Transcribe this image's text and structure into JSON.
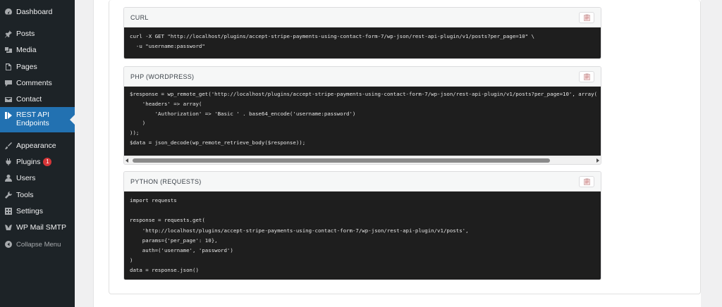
{
  "sidebar": {
    "items": [
      {
        "label": "Dashboard",
        "icon": "dashboard-icon"
      },
      {
        "label": "Posts",
        "icon": "pin-icon"
      },
      {
        "label": "Media",
        "icon": "media-icon"
      },
      {
        "label": "Pages",
        "icon": "page-icon"
      },
      {
        "label": "Comments",
        "icon": "comment-icon"
      },
      {
        "label": "Contact",
        "icon": "envelope-icon"
      },
      {
        "label": "REST API Endpoints",
        "icon": "rest-api-icon",
        "active": true
      },
      {
        "label": "Appearance",
        "icon": "brush-icon"
      },
      {
        "label": "Plugins",
        "icon": "plugin-icon",
        "badge": "1"
      },
      {
        "label": "Users",
        "icon": "user-icon"
      },
      {
        "label": "Tools",
        "icon": "wrench-icon"
      },
      {
        "label": "Settings",
        "icon": "settings-icon"
      },
      {
        "label": "WP Mail SMTP",
        "icon": "mail-smtp-icon"
      },
      {
        "label": "Collapse Menu",
        "icon": "collapse-icon"
      }
    ]
  },
  "code_blocks": [
    {
      "title": "CURL",
      "code": "curl -X GET \"http://localhost/plugins/accept-stripe-payments-using-contact-form-7/wp-json/rest-api-plugin/v1/posts?per_page=10\" \\\n  -u \"username:password\""
    },
    {
      "title": "PHP (WORDPRESS)",
      "code": "$response = wp_remote_get('http://localhost/plugins/accept-stripe-payments-using-contact-form-7/wp-json/rest-api-plugin/v1/posts?per_page=10', array(\n    'headers' => array(\n        'Authorization' => 'Basic ' . base64_encode('username:password')\n    )\n));\n$data = json_decode(wp_remote_retrieve_body($response));"
    },
    {
      "title": "PYTHON (REQUESTS)",
      "code": "import requests\n\nresponse = requests.get(\n    'http://localhost/plugins/accept-stripe-payments-using-contact-form-7/wp-json/rest-api-plugin/v1/posts',\n    params={'per_page': 10},\n    auth=('username', 'password')\n)\ndata = response.json()"
    }
  ],
  "colors": {
    "sidebar_bg": "#1d2327",
    "active_menu": "#2271b1",
    "code_bg": "#1e1e1e",
    "badge": "#d63638"
  }
}
